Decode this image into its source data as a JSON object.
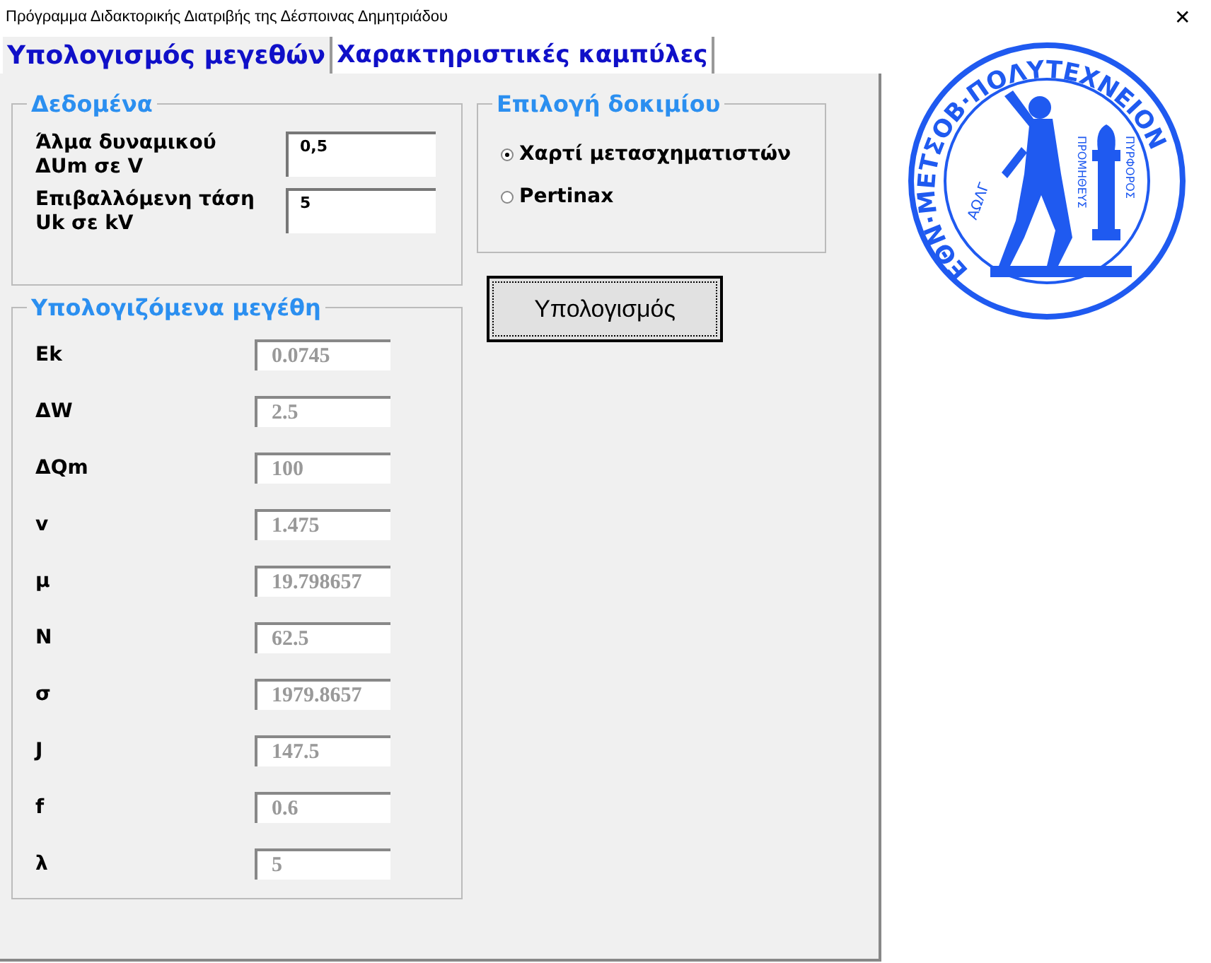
{
  "window": {
    "title": "Πρόγραμμα Διδακτορικής Διατριβής της Δέσποινας Δημητριάδου",
    "close": "✕"
  },
  "tabs": [
    {
      "label": "Υπολογισμός μεγεθών",
      "selected": true
    },
    {
      "label": "Χαρακτηριστικές καμπύλες",
      "selected": false
    }
  ],
  "inputs": {
    "title": "Δεδομένα",
    "fields": [
      {
        "label": "Άλμα δυναμικού ΔUm σε V",
        "value": "0,5"
      },
      {
        "label": "Επιβαλλόμενη τάση Uk σε kV",
        "value": "5"
      }
    ]
  },
  "specimen": {
    "title": "Επιλογή δοκιμίου",
    "options": [
      {
        "label": "Χαρτί μετασχηματιστών",
        "selected": true
      },
      {
        "label": "Pertinax",
        "selected": false
      }
    ]
  },
  "calculate_button": "Υπολογισμός",
  "results": {
    "title": "Υπολογιζόμενα μεγέθη",
    "rows": [
      {
        "label": "Ek",
        "value": "0.0745"
      },
      {
        "label": "ΔW",
        "value": "2.5"
      },
      {
        "label": "ΔQm",
        "value": "100"
      },
      {
        "label": "v",
        "value": "1.475"
      },
      {
        "label": "μ",
        "value": "19.798657"
      },
      {
        "label": "N",
        "value": "62.5"
      },
      {
        "label": "σ",
        "value": "1979.8657"
      },
      {
        "label": "J",
        "value": "147.5"
      },
      {
        "label": "f",
        "value": "0.6"
      },
      {
        "label": "λ",
        "value": "5"
      }
    ]
  },
  "logo": {
    "ring_text": "ΕΘΝ·ΜΕΤΣΟΒ·ΠΟΛΥΤΕΧΝΕΙΟΝ",
    "year": "ΑΩΛΓ",
    "left_text": "ΠΡΟΜΗΘΕΥΣ",
    "right_text": "ΠΥΡΦΟΡΟΣ"
  }
}
